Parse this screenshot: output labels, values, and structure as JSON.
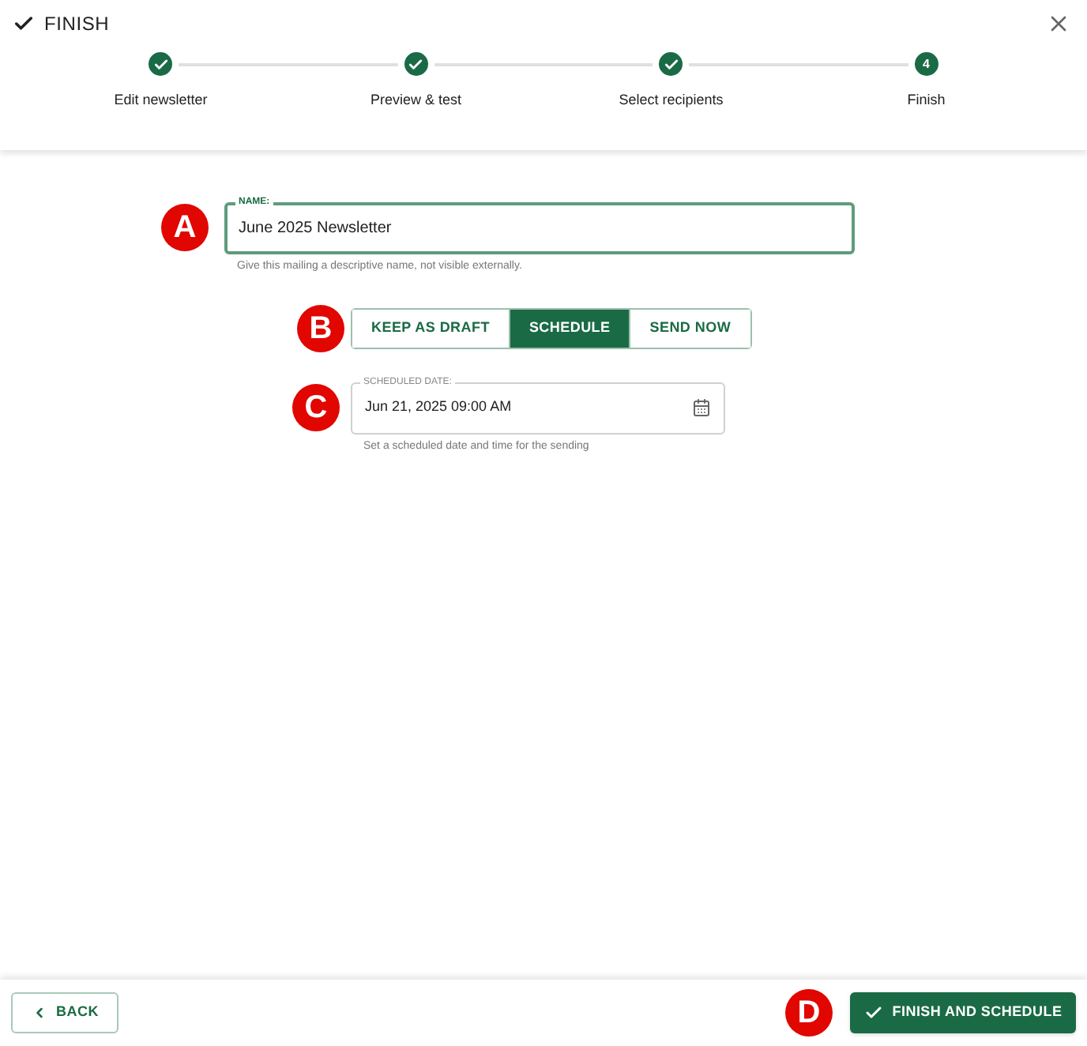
{
  "header": {
    "title": "FINISH"
  },
  "steps": [
    {
      "label": "Edit newsletter",
      "completed": true
    },
    {
      "label": "Preview & test",
      "completed": true
    },
    {
      "label": "Select recipients",
      "completed": true
    },
    {
      "label": "Finish",
      "number": "4",
      "completed": false
    }
  ],
  "name_field": {
    "label": "NAME:",
    "value": "June 2025 Newsletter",
    "helper": "Give this mailing a descriptive name, not visible externally.",
    "marker": "A"
  },
  "send_mode": {
    "marker": "B",
    "options": [
      {
        "label": "KEEP AS DRAFT",
        "selected": false
      },
      {
        "label": "SCHEDULE",
        "selected": true
      },
      {
        "label": "SEND NOW",
        "selected": false
      }
    ]
  },
  "date_field": {
    "label": "SCHEDULED DATE:",
    "value": "Jun 21, 2025 09:00 AM",
    "helper": "Set a scheduled date and time for the sending",
    "marker": "C"
  },
  "footer": {
    "back": "BACK",
    "finish": "FINISH AND SCHEDULE",
    "marker": "D"
  }
}
